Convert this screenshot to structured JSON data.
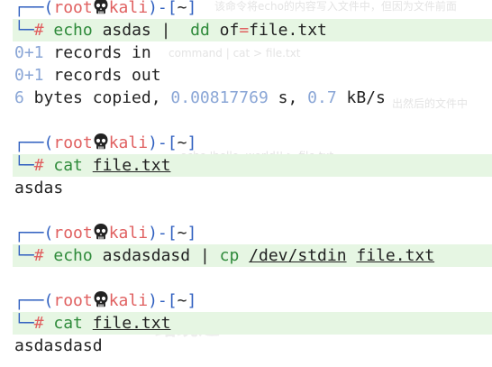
{
  "terminal": {
    "prompt": {
      "top_prefix": "┌──(",
      "user": "root",
      "host": "kali",
      "after_host": ")-[",
      "path": "~",
      "close": "]",
      "bottom_prefix": "└─",
      "hash": "#"
    },
    "block1": {
      "cmd1": "echo",
      "arg1": " asdas ",
      "pipe": "|",
      "gap": "  ",
      "cmd2": "dd",
      "arg2a": " of",
      "eq": "=",
      "arg2b": "file.txt",
      "out1_num": "0+1",
      "out1_text": " records in",
      "out2_num": "0+1",
      "out2_text": " records out",
      "out3_num1": "6",
      "out3_text1": " bytes copied, ",
      "out3_num2": "0.00817769",
      "out3_text2": " s, ",
      "out3_num3": "0.7",
      "out3_text3": " kB/s"
    },
    "block2": {
      "cmd": "cat",
      "file": "file.txt",
      "output": "asdas"
    },
    "block3": {
      "cmd1": "echo",
      "arg1": " asdasdasd ",
      "pipe": "|",
      "cmd2": "cp",
      "src": "/dev/stdin",
      "dst": "file.txt"
    },
    "block4": {
      "cmd": "cat",
      "file": "file.txt",
      "output": "asdasdasd"
    }
  },
  "background_ghost": {
    "g1": "该命令将echo的内容写入文件中，但因为文件前面",
    "g2": "command | cat > file.txt",
    "g3": "出然后的文件中",
    "g4": "echo 'hello, world!' > file.txt",
    "g5": "路绕过"
  },
  "colors": {
    "prompt_frame": "#3060c0",
    "user_host": "#e06060",
    "command": "#2e8a3a",
    "highlight_bg": "#e6f6e3",
    "number": "#8aa6d6"
  }
}
